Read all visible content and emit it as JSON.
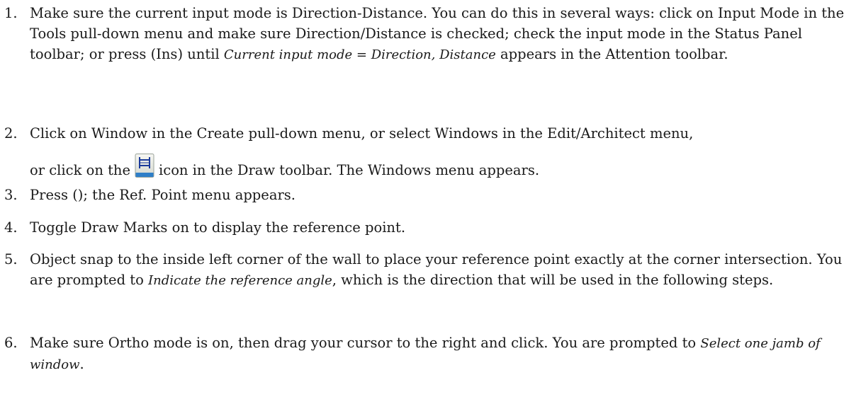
{
  "steps": [
    {
      "number": "1.",
      "text_a": "Make sure the current input mode is Direction-Distance. You can do this in several ways: click on Input Mode in the Tools pull-down menu and make sure Direction/Distance is checked; check the input mode in the Status Panel toolbar; or press (Ins) until ",
      "text_em": "Current input mode = Direction, Distance",
      "text_b": " appears in the Attention toolbar."
    },
    {
      "number": "2.",
      "text_a": "Click on Window in the Create pull-down menu, or select Windows in the Edit/Architect menu,",
      "text_b": "or click on the",
      "icon": "window-tool-icon",
      "text_c": "icon in the Draw toolbar. The Windows menu appears."
    },
    {
      "number": "3.",
      "text": "Press (); the Ref. Point menu appears."
    },
    {
      "number": "4.",
      "text": "Toggle Draw Marks on to display the reference point."
    },
    {
      "number": "5.",
      "text_a": "Object snap to the inside left corner of the wall to place your reference point exactly at the corner intersection. You are prompted to ",
      "text_em": "Indicate the reference angle",
      "text_b": ", which is the direction that will be used in the following steps."
    },
    {
      "number": "6.",
      "text_a": "Make sure Ortho mode is on, then drag your cursor to the right and click. You are prompted to ",
      "text_em": "Select one jamb of window",
      "text_b": "."
    }
  ]
}
